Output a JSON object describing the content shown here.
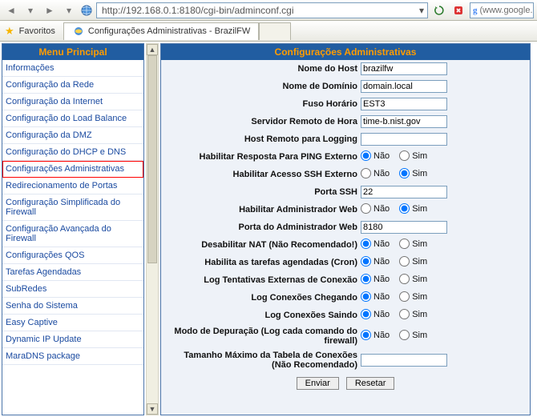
{
  "browser": {
    "url": "http://192.168.0.1:8180/cgi-bin/adminconf.cgi",
    "favorites_label": "Favoritos",
    "tab_title": "Configurações Administrativas - BrazilFW",
    "search_placeholder": "(www.google.c"
  },
  "menu": {
    "header": "Menu Principal",
    "items": [
      "Informações",
      "Configuração da Rede",
      "Configuração da Internet",
      "Configuração do Load Balance",
      "Configuração da DMZ",
      "Configuração do DHCP e DNS",
      "Configurações Administrativas",
      "Redirecionamento de Portas",
      "Configuração Simplificada do Firewall",
      "Configuração Avançada do Firewall",
      "Configurações QOS",
      "Tarefas Agendadas",
      "SubRedes",
      "Senha do Sistema",
      "Easy Captive",
      "Dynamic IP Update",
      "MaraDNS package"
    ],
    "selected_index": 6
  },
  "panel": {
    "header": "Configurações Administrativas",
    "nao": "Não",
    "sim": "Sim",
    "rows": [
      {
        "label": "Nome do Host",
        "type": "text",
        "value": "brazilfw"
      },
      {
        "label": "Nome de Domínio",
        "type": "text",
        "value": "domain.local"
      },
      {
        "label": "Fuso Horário",
        "type": "text",
        "value": "EST3"
      },
      {
        "label": "Servidor Remoto de Hora",
        "type": "text",
        "value": "time-b.nist.gov"
      },
      {
        "label": "Host Remoto para Logging",
        "type": "text",
        "value": ""
      },
      {
        "label": "Habilitar Resposta Para PING Externo",
        "type": "radio",
        "value": "nao"
      },
      {
        "label": "Habilitar Acesso SSH Externo",
        "type": "radio",
        "value": "sim"
      },
      {
        "label": "Porta SSH",
        "type": "text",
        "value": "22"
      },
      {
        "label": "Habilitar Administrador Web",
        "type": "radio",
        "value": "sim"
      },
      {
        "label": "Porta do Administrador Web",
        "type": "text",
        "value": "8180"
      },
      {
        "label": "Desabilitar NAT (Não Recomendado!)",
        "type": "radio",
        "value": "nao"
      },
      {
        "label": "Habilita as tarefas agendadas (Cron)",
        "type": "radio",
        "value": "nao"
      },
      {
        "label": "Log Tentativas Externas de Conexão",
        "type": "radio",
        "value": "nao"
      },
      {
        "label": "Log Conexões Chegando",
        "type": "radio",
        "value": "nao"
      },
      {
        "label": "Log Conexões Saindo",
        "type": "radio",
        "value": "nao"
      },
      {
        "label": "Modo de Depuração (Log cada comando do firewall)",
        "type": "radio",
        "value": "nao"
      },
      {
        "label": "Tamanho Máximo da Tabela de Conexões (Não Recomendado)",
        "type": "text",
        "value": ""
      }
    ],
    "submit": "Enviar",
    "reset": "Resetar"
  }
}
